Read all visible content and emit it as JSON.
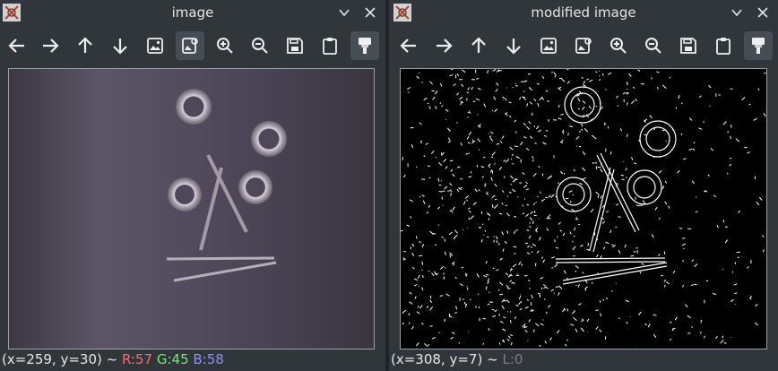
{
  "left_window": {
    "title": "image",
    "status": {
      "coords": "(x=259, y=30) ~",
      "r": "R:57",
      "g": "G:45",
      "b": "B:58"
    }
  },
  "right_window": {
    "title": "modified image",
    "status": {
      "coords": "(x=308, y=7) ~",
      "l": "L:0"
    }
  },
  "toolbar_icons": [
    "arrow-left-icon",
    "arrow-right-icon",
    "arrow-up-icon",
    "arrow-down-icon",
    "image-icon",
    "image-settings-icon",
    "zoom-in-icon",
    "zoom-out-icon",
    "save-icon",
    "clipboard-icon",
    "brush-icon"
  ],
  "colors": {
    "window_bg": "#31363b",
    "text": "#e6e6e6",
    "status_r": "#ff6b6b",
    "status_g": "#7be37b",
    "status_b": "#8f8fff",
    "status_l": "#7d7d7d"
  }
}
